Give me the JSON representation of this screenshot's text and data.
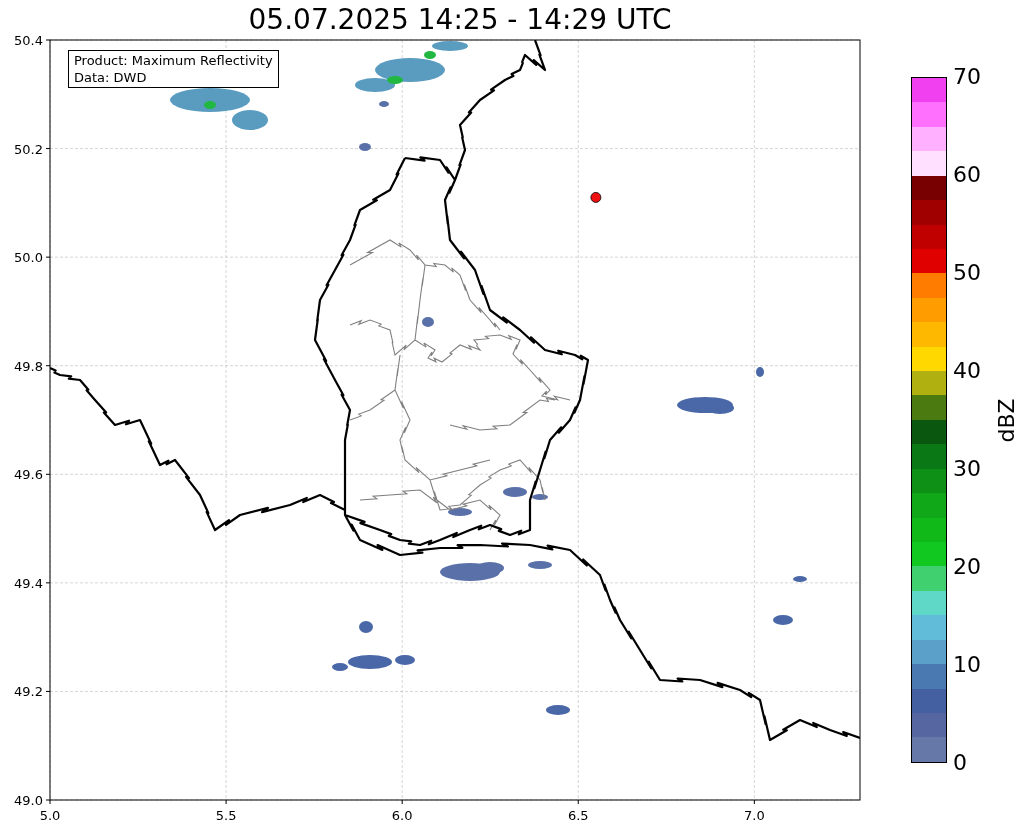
{
  "title": "05.07.2025 14:25 - 14:29 UTC",
  "info_box": {
    "lines": [
      "Product: Maximum Reflectivity",
      "Data: DWD"
    ]
  },
  "map": {
    "chart_data": {
      "type": "scatter",
      "grid": true,
      "xlim": [
        5,
        7.3
      ],
      "ylim": [
        49,
        50.4
      ],
      "xticks": [
        {
          "value": 5,
          "label": "5.0"
        },
        {
          "value": 5.5,
          "label": "5.5"
        },
        {
          "value": 6,
          "label": "6.0"
        },
        {
          "value": 6.5,
          "label": "6.5"
        },
        {
          "value": 7,
          "label": "7.0"
        }
      ],
      "yticks": [
        {
          "value": 49,
          "label": "49.0"
        },
        {
          "value": 49.2,
          "label": "49.2"
        },
        {
          "value": 49.4,
          "label": "49.4"
        },
        {
          "value": 49.6,
          "label": "49.6"
        },
        {
          "value": 49.8,
          "label": "49.8"
        },
        {
          "value": 50,
          "label": "50.0"
        },
        {
          "value": 50.2,
          "label": "50.2"
        },
        {
          "value": 50.4,
          "label": "50.4"
        }
      ],
      "x": [
        6.55
      ],
      "series": [
        {
          "color": "#ee1111",
          "values": [
            50.11
          ]
        }
      ]
    }
  },
  "colorbar": {
    "label": "dBZ",
    "ticks": [
      "70",
      "60",
      "50",
      "40",
      "30",
      "20",
      "10",
      "0"
    ],
    "segments": [
      {
        "color": "#f040f0"
      },
      {
        "color": "#ff70ff"
      },
      {
        "color": "#ffb0ff"
      },
      {
        "color": "#ffe0ff"
      },
      {
        "color": "#780000"
      },
      {
        "color": "#a00000"
      },
      {
        "color": "#c00000"
      },
      {
        "color": "#e00000"
      },
      {
        "color": "#ff7c00"
      },
      {
        "color": "#ff9c00"
      },
      {
        "color": "#ffb800"
      },
      {
        "color": "#ffd800"
      },
      {
        "color": "#b0b010"
      },
      {
        "color": "#4a7a10"
      },
      {
        "color": "#0a5810"
      },
      {
        "color": "#0a7814"
      },
      {
        "color": "#0e9016"
      },
      {
        "color": "#10a818"
      },
      {
        "color": "#10b818"
      },
      {
        "color": "#10c820"
      },
      {
        "color": "#40d070"
      },
      {
        "color": "#60d8c8"
      },
      {
        "color": "#60bcd8"
      },
      {
        "color": "#5aa0c8"
      },
      {
        "color": "#4a78b0"
      },
      {
        "color": "#4460a0"
      },
      {
        "color": "#5566a0"
      },
      {
        "color": "#6678a8"
      }
    ]
  }
}
